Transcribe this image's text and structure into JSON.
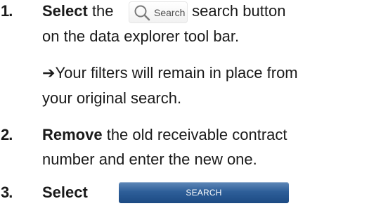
{
  "steps": [
    {
      "number": "1.",
      "verb": "Select",
      "text_before": " the ",
      "text_after": " search button",
      "line2": "on the data explorer tool bar.",
      "arrow": "➔",
      "note_line1": "Your filters will remain in place from",
      "note_line2": "your original search.",
      "button_label": "Search",
      "button_icon": "magnifier-icon"
    },
    {
      "number": "2.",
      "verb": "Remove",
      "line1_rest": " the old receivable contract",
      "line2": "number and enter the new one."
    },
    {
      "number": "3.",
      "verb": "Select",
      "button_label": "SEARCH"
    }
  ]
}
